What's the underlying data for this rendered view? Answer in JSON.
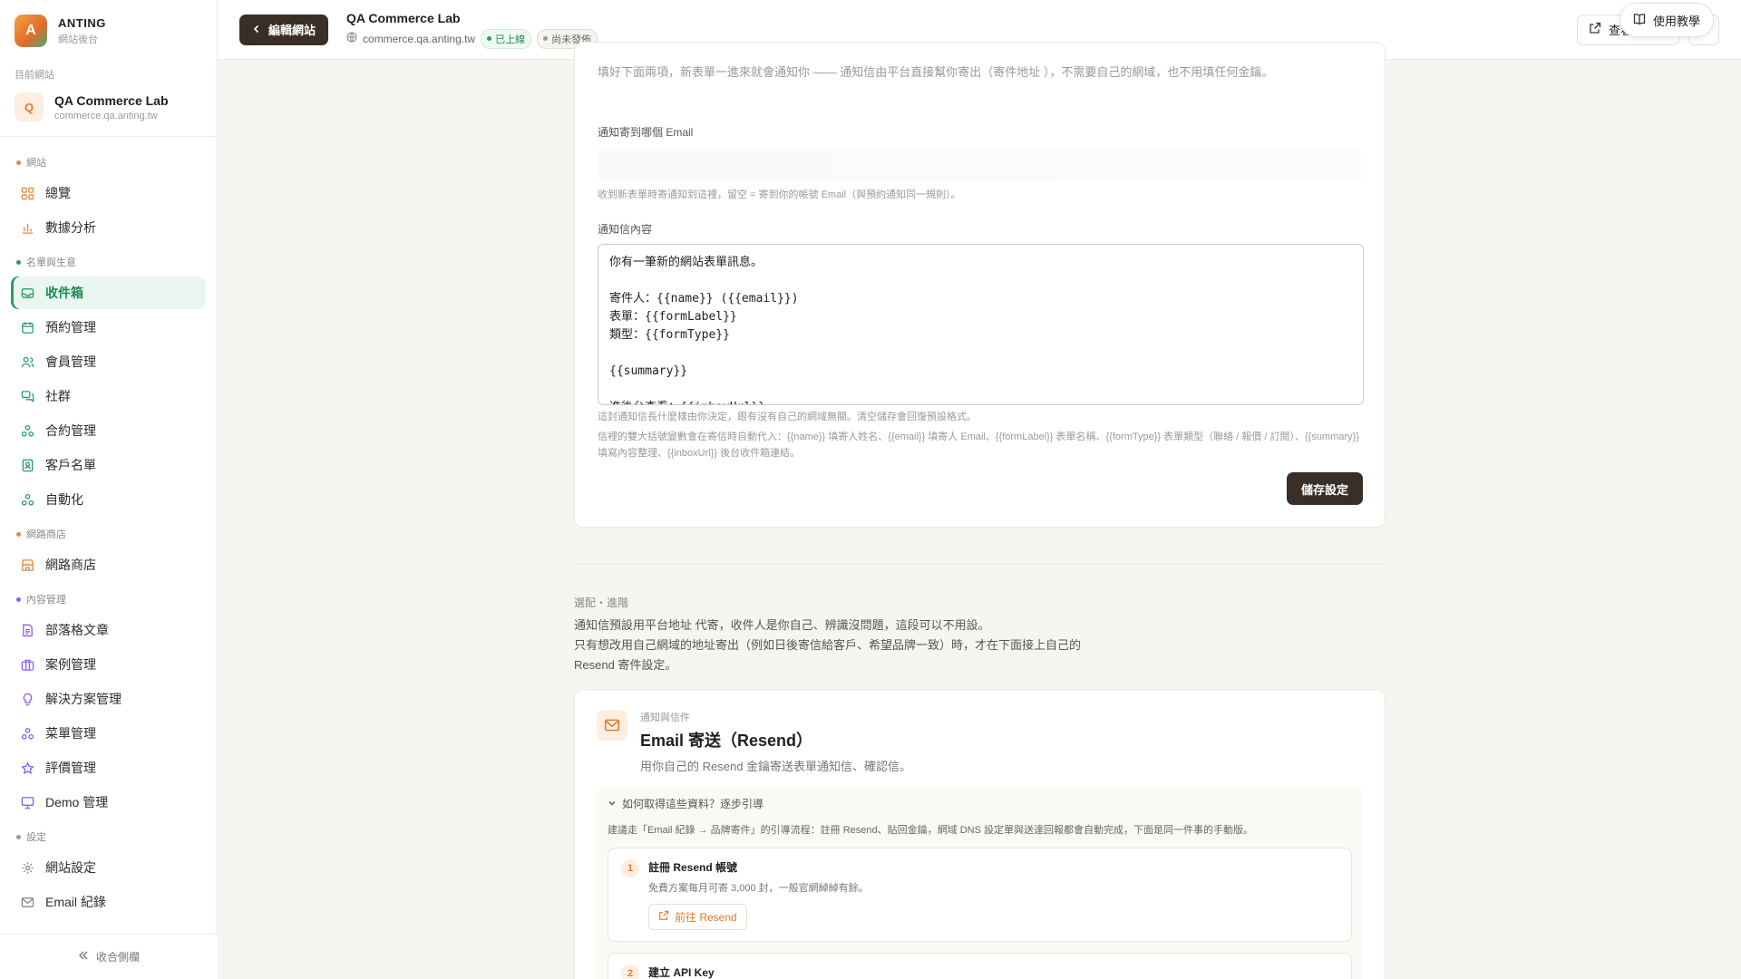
{
  "brand": {
    "letter": "A",
    "name": "ANTING",
    "sub": "網站後台"
  },
  "current": {
    "label": "目前網站",
    "avatar": "Q",
    "name": "QA Commerce Lab",
    "domain": "commerce.qa.anting.tw"
  },
  "nav": {
    "g1": {
      "label": "網站",
      "color": "#e08a3a"
    },
    "g1_items": [
      "總覽",
      "數據分析"
    ],
    "g2": {
      "label": "名單與生意",
      "color": "#2a9d63"
    },
    "g2_items": [
      "收件箱",
      "預約管理",
      "會員管理",
      "社群",
      "合約管理",
      "客戶名單",
      "自動化"
    ],
    "g3": {
      "label": "網路商店",
      "color": "#e08a3a"
    },
    "g3_items": [
      "網路商店"
    ],
    "g4": {
      "label": "內容管理",
      "color": "#8a5cf6"
    },
    "g4_items": [
      "部落格文章",
      "案例管理",
      "解決方案管理",
      "菜單管理",
      "評價管理",
      "Demo 管理"
    ],
    "g5": {
      "label": "設定",
      "color": "#999999"
    },
    "g5_items": [
      "網站設定",
      "Email 紀錄"
    ],
    "collapse": "收合側欄"
  },
  "topbar": {
    "back": "編輯網站",
    "title": "QA Commerce Lab",
    "domain": "commerce.qa.anting.tw",
    "status_live": "已上線",
    "status_unpub": "尚未發佈",
    "view": "查看公開站",
    "tutorial": "使用教學"
  },
  "form": {
    "intro": "填好下面兩項，新表單一進來就會通知你 —— 通知信由平台直接幫你寄出（寄件地址 ），不需要自己的網域，也不用填任何金鑰。",
    "email_label": "通知寄到哪個 Email",
    "email_help": "收到新表單時寄通知到這裡，留空 = 寄到你的帳號 Email（與預約通知同一規則）。",
    "content_label": "通知信內容",
    "content_value": "你有一筆新的網站表單訊息。\n\n寄件人：{{name}} ({{email}})\n表單：{{formLabel}}\n類型：{{formType}}\n\n{{summary}}\n\n進後台查看：{{inboxUrl}}",
    "help1": "這封通知信長什麼樣由你決定，跟有沒有自己的網域無關。清空儲存會回復預設格式。",
    "help2": "信裡的雙大括號變數會在寄信時自動代入：{{name}} 填寄人姓名、{{email}} 填寄人 Email、{{formLabel}} 表單名稱、{{formType}} 表單類型（聯絡 / 報價 / 訂閱）、{{summary}} 填寫內容整理、{{inboxUrl}} 後台收件箱連結。",
    "save": "儲存設定"
  },
  "advanced": {
    "kicker": "選配・進階",
    "line1": "通知信預設用平台地址 代寄，收件人是你自己、辨識沒問題，這段可以不用設。",
    "line2": "只有想改用自己網域的地址寄出（例如日後寄信給客戶、希望品牌一致）時，才在下面接上自己的 Resend 寄件設定。"
  },
  "resend": {
    "kicker": "通知與信件",
    "title": "Email 寄送（Resend）",
    "desc": "用你自己的 Resend 金鑰寄送表單通知信、確認信。",
    "guide_toggle": "如何取得這些資料？逐步引導",
    "guide_note": "建議走「Email 紀錄 → 品牌寄件」的引導流程：註冊 Resend、貼回金鑰，網域 DNS 設定單與送達回報都會自動完成，下面是同一件事的手動版。",
    "step1_num": "1",
    "step1_title": "註冊 Resend 帳號",
    "step1_desc": "免費方案每月可寄 3,000 封，一般官網綽綽有餘。",
    "step1_link": "前往 Resend",
    "step2_num": "2",
    "step2_title": "建立 API Key"
  }
}
